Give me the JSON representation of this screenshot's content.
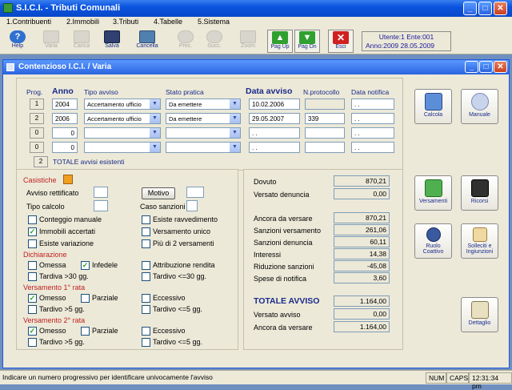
{
  "app": {
    "title": "S.I.C.I. - Tributi Comunali"
  },
  "menu": [
    "1.Contribuenti",
    "2.Immobili",
    "3.Tributi",
    "4.Tabelle",
    "5.Sistema"
  ],
  "toolbar": {
    "help": "Help",
    "help_key": "F1",
    "varia": "Varia",
    "carica": "Carica",
    "salva": "Salva",
    "salva_key": "F10",
    "cancella": "Cancella",
    "cancella_key": "F5",
    "prec": "Prec.",
    "succ": "Succ.",
    "zoom": "Zoom",
    "pag_up": "Pag Up",
    "pag_dn": "Pag Dn",
    "esci": "Esci"
  },
  "user": {
    "line1": "Utente:1  Ente:001",
    "line2": "Anno:2009 28.05.2009"
  },
  "window": {
    "title": "Contenzioso I.C.I. / Varia"
  },
  "grid": {
    "headers": {
      "prog": "Prog.",
      "anno": "Anno",
      "tipo": "Tipo avviso",
      "stato": "Stato pratica",
      "data": "Data avviso",
      "nprot": "N.protocollo",
      "notifica": "Data notifica"
    },
    "rows": [
      {
        "prog": "1",
        "anno": "2004",
        "tipo": "Accertamento ufficio",
        "stato": "Da emettere",
        "data": "10.02.2006",
        "nprot": "",
        "notifica": ". ."
      },
      {
        "prog": "2",
        "anno": "2006",
        "tipo": "Accertamento ufficio",
        "stato": "Da emettere",
        "data": "29.05.2007",
        "nprot": "339",
        "notifica": ". ."
      },
      {
        "prog": "0",
        "anno": "0",
        "tipo": "",
        "stato": "",
        "data": ". .",
        "nprot": "",
        "notifica": ". ."
      },
      {
        "prog": "0",
        "anno": "0",
        "tipo": "",
        "stato": "",
        "data": ". .",
        "nprot": "",
        "notifica": ". ."
      }
    ],
    "total_count": "2",
    "total_label": "TOTALE avvisi esistenti"
  },
  "casistiche": {
    "title": "Casistiche",
    "avviso_rettificato": "Avviso rettificato",
    "motivo": "Motivo",
    "tipo_calcolo": "Tipo calcolo",
    "caso_sanzioni": "Caso sanzioni",
    "conteggio_manuale": "Conteggio manuale",
    "esiste_ravvedimento": "Esiste ravvedimento",
    "immobili_accertati": "Immobili accertati",
    "versamento_unico": "Versamento unico",
    "esiste_variazione": "Esiste variazione",
    "piu_2_versamenti": "Più di 2 versamenti",
    "dichiarazione": "Dichiarazione",
    "omessa": "Omessa",
    "infedele": "Infedele",
    "attribuzione_rendita": "Attribuzione rendita",
    "tardiva_30": "Tardiva >30 gg.",
    "tardivo_le30": "Tardivo <=30 gg.",
    "vers1": "Versamento 1° rata",
    "vers2": "Versamento 2° rata",
    "omesso": "Omesso",
    "parziale": "Parziale",
    "eccessivo": "Eccessivo",
    "tardivo_5": "Tardivo >5 gg.",
    "tardivo_le5": "Tardivo <=5 gg."
  },
  "totals": {
    "dovuto": {
      "label": "Dovuto",
      "value": "870,21"
    },
    "versato_denuncia": {
      "label": "Versato denuncia",
      "value": "0,00"
    },
    "ancora_da_versare": {
      "label": "Ancora da versare",
      "value": "870,21"
    },
    "sanzioni_versamento": {
      "label": "Sanzioni versamento",
      "value": "261,06"
    },
    "sanzioni_denuncia": {
      "label": "Sanzioni denuncia",
      "value": "60,11"
    },
    "interessi": {
      "label": "Interessi",
      "value": "14,38"
    },
    "riduzione_sanzioni": {
      "label": "Riduzione sanzioni",
      "value": "-45,08"
    },
    "spese_notifica": {
      "label": "Spese di notifica",
      "value": "3,60"
    },
    "totale_avviso": {
      "label": "TOTALE AVVISO",
      "value": "1.164,00"
    },
    "versato_avviso": {
      "label": "Versato avviso",
      "value": "0,00"
    },
    "ancora_da_versare2": {
      "label": "Ancora da versare",
      "value": "1.164,00"
    }
  },
  "side_buttons": {
    "calcola": "Calcola",
    "manuale": "Manuale",
    "versamenti": "Versamenti",
    "ricorsi": "Ricorsi",
    "ruolo1": "Ruolo",
    "ruolo2": "Coattivo",
    "solleciti1": "Solleciti e",
    "solleciti2": "Ingiunzioni",
    "dettaglio": "Dettaglio"
  },
  "status": {
    "message": "Indicare un numero progressivo per identificare univocamente l'avviso",
    "num": "NUM",
    "caps": "CAPS",
    "time": "12:31:34 pm"
  }
}
